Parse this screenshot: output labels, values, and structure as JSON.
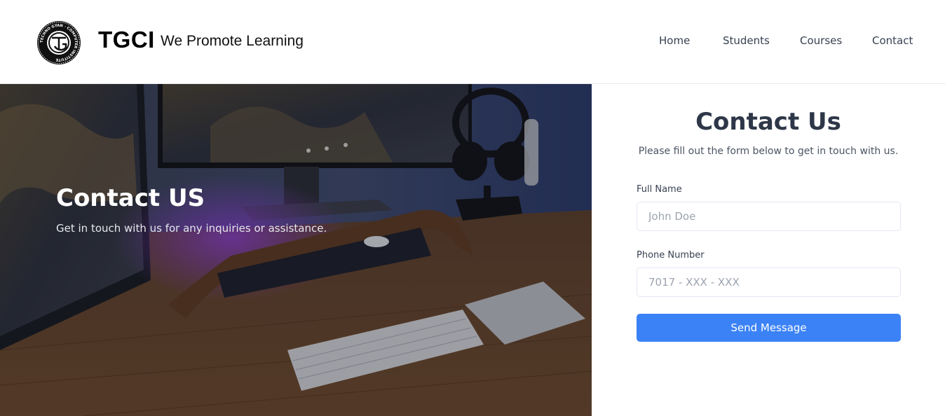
{
  "brand": {
    "name": "TGCI",
    "tagline": "We Promote Learning",
    "logo_ring_text": "TECHNO GYAN · COMPUTER INSTITUTE",
    "logo_monogram": "TG"
  },
  "nav": {
    "items": [
      {
        "label": "Home"
      },
      {
        "label": "Students"
      },
      {
        "label": "Courses"
      },
      {
        "label": "Contact"
      }
    ]
  },
  "hero": {
    "title": "Contact US",
    "subtitle": "Get in touch with us for any inquiries or assistance."
  },
  "form": {
    "title": "Contact Us",
    "subtitle": "Please fill out the form below to get in touch with us.",
    "full_name": {
      "label": "Full Name",
      "placeholder": "John Doe",
      "value": ""
    },
    "phone": {
      "label": "Phone Number",
      "placeholder": "7017 - XXX - XXX",
      "value": ""
    },
    "submit_label": "Send Message"
  },
  "colors": {
    "accent": "#3b82f6",
    "heading": "#2d3748",
    "nav_text": "#374151"
  }
}
